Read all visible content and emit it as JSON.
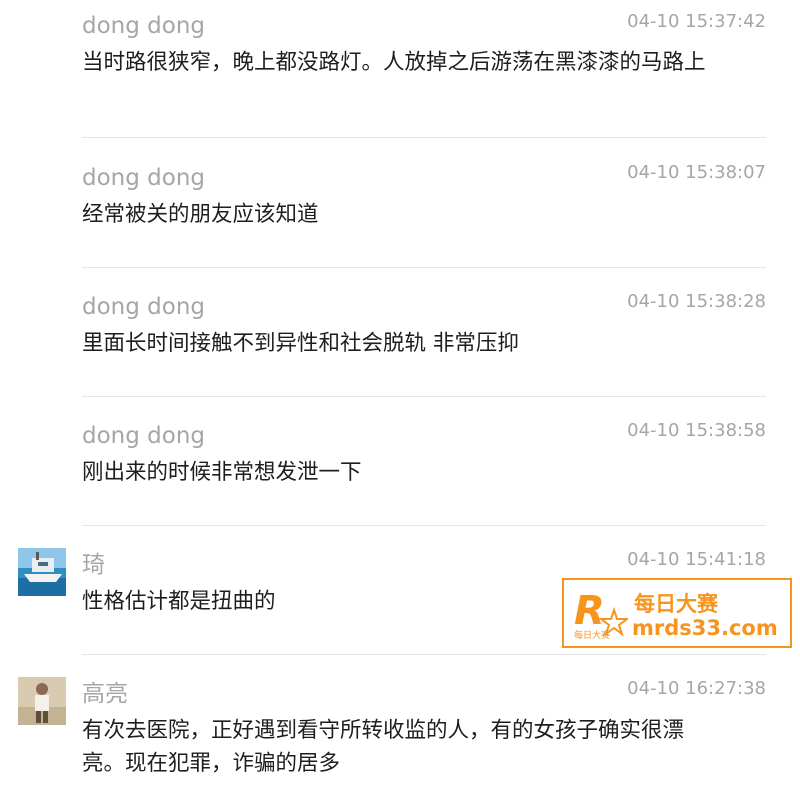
{
  "comments": [
    {
      "user": "dong dong",
      "time": "04-10 15:37:42",
      "text": "当时路很狭窄，晚上都没路灯。人放掉之后游荡在黑漆漆的马路上"
    },
    {
      "user": "dong dong",
      "time": "04-10 15:38:07",
      "text": "经常被关的朋友应该知道"
    },
    {
      "user": "dong dong",
      "time": "04-10 15:38:28",
      "text": "里面长时间接触不到异性和社会脱轨 非常压抑"
    },
    {
      "user": "dong dong",
      "time": "04-10 15:38:58",
      "text": "刚出来的时候非常想发泄一下"
    },
    {
      "user": "琦",
      "time": "04-10 15:41:18",
      "text": "性格估计都是扭曲的"
    },
    {
      "user": "高亮",
      "time": "04-10 16:27:38",
      "text": "有次去医院，正好遇到看守所转收监的人，有的女孩子确实很漂亮。现在犯罪，诈骗的居多"
    }
  ],
  "watermark": {
    "title": "每日大赛",
    "url": "mrds33.com",
    "logo_letter": "R",
    "logo_sub": "每日大赛"
  },
  "colors": {
    "accent": "#f7941d",
    "meta": "#a6a6a6",
    "text": "#1e1e1e",
    "divider": "#e6e6e6"
  }
}
